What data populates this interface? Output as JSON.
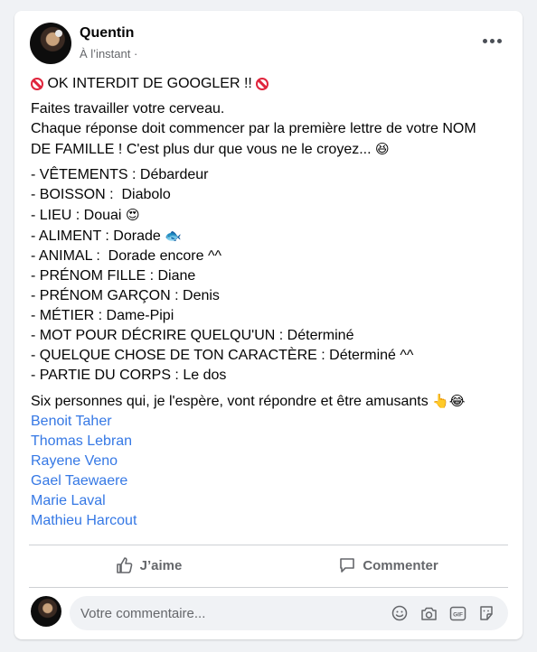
{
  "post": {
    "author": "Quentin",
    "timestamp": "À l’instant ·",
    "title_text": "OK INTERDIT DE GOOGLER !!",
    "intro_line1": "Faites travailler votre cerveau.",
    "intro_line2": "Chaque réponse doit commencer par la première lettre de votre NOM",
    "intro_line3": "DE FAMILLE ! C'est plus dur que vous ne le croyez...",
    "list_items": [
      "- VÊTEMENTS : Débardeur",
      "- BOISSON :  Diabolo",
      "- LIEU : Douai",
      "- ALIMENT : Dorade",
      "- ANIMAL :  Dorade encore ^^",
      "- PRÉNOM FILLE : Diane",
      "- PRÉNOM GARÇON : Denis",
      "- MÉTIER : Dame-Pipi",
      "- MOT POUR DÉCRIRE QUELQU'UN : Déterminé",
      "- QUELQUE CHOSE DE TON CARACTÈRE : Déterminé ^^",
      "- PARTIE DU CORPS : Le dos"
    ],
    "closing": "Six personnes qui, je l'espère, vont répondre et être amusants",
    "tagged": [
      "Benoit Taher",
      "Thomas Lebran",
      "Rayene Veno",
      "Gael Taewaere",
      "Marie Laval",
      "Mathieu Harcout"
    ]
  },
  "actions": {
    "like_label": "J’aime",
    "comment_label": "Commenter"
  },
  "comment": {
    "placeholder": "Votre commentaire..."
  },
  "colors": {
    "link": "#3578e5",
    "secondary_text": "#65676b",
    "background": "#f0f2f5"
  },
  "icons": [
    "more-options-icon",
    "prohibited-icon",
    "grinning-squinting-icon",
    "heart-eyes-icon",
    "fish-icon",
    "pointing-hand-icon",
    "tears-of-joy-icon",
    "thumbs-up-icon",
    "comment-icon",
    "smiley-icon",
    "camera-icon",
    "gif-icon",
    "sticker-icon"
  ]
}
